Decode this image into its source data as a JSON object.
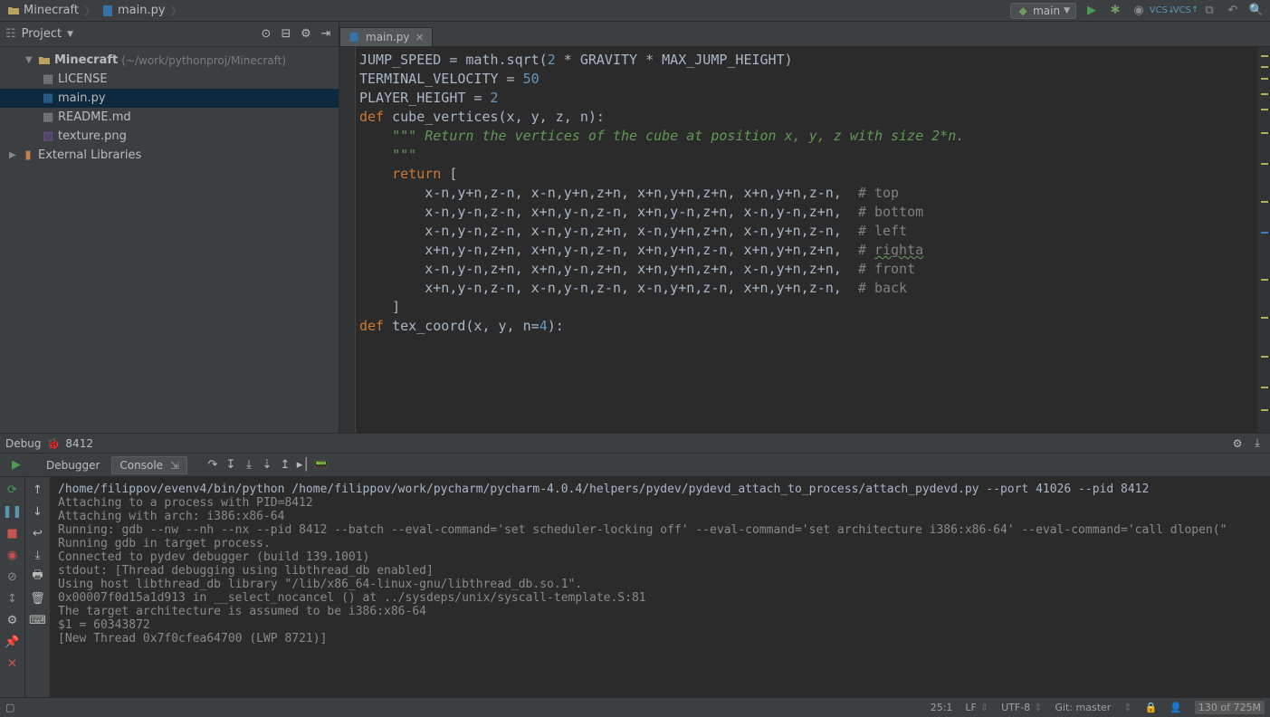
{
  "breadcrumb": {
    "project": "Minecraft",
    "file": "main.py"
  },
  "run_config": "main",
  "sidebar": {
    "title": "Project",
    "root": "Minecraft",
    "root_path": "(~/work/pythonproj/Minecraft)",
    "items": [
      {
        "name": "LICENSE",
        "icon": "text",
        "selected": false
      },
      {
        "name": "main.py",
        "icon": "py",
        "selected": true
      },
      {
        "name": "README.md",
        "icon": "text",
        "selected": false
      },
      {
        "name": "texture.png",
        "icon": "img",
        "selected": false
      }
    ],
    "external": "External Libraries"
  },
  "tabs": [
    {
      "label": "main.py"
    }
  ],
  "code_lines": [
    {
      "t": "JUMP_SPEED = math.sqrt(",
      "seg": [
        {
          "s": "JUMP_SPEED = math.sqrt("
        },
        {
          "s": "2",
          "c": "num"
        },
        {
          "s": " * GRAVITY * MAX_JUMP_HEIGHT)"
        }
      ]
    },
    {
      "seg": [
        {
          "s": "TERMINAL_VELOCITY = "
        },
        {
          "s": "50",
          "c": "num"
        }
      ]
    },
    {
      "seg": [
        {
          "s": ""
        }
      ]
    },
    {
      "seg": [
        {
          "s": "PLAYER_HEIGHT = "
        },
        {
          "s": "2",
          "c": "num"
        }
      ]
    },
    {
      "seg": [
        {
          "s": ""
        }
      ]
    },
    {
      "seg": [
        {
          "s": "def ",
          "c": "kw"
        },
        {
          "s": "cube_vertices"
        },
        {
          "s": "(x, y, z, n):"
        }
      ]
    },
    {
      "seg": [
        {
          "s": "    \"\"\" Return the vertices of the cube at position x, y, z with size 2*n.",
          "c": "doc"
        }
      ]
    },
    {
      "seg": [
        {
          "s": ""
        }
      ]
    },
    {
      "seg": [
        {
          "s": "    \"\"\"",
          "c": "doc"
        }
      ]
    },
    {
      "seg": [
        {
          "s": "    "
        },
        {
          "s": "return ",
          "c": "kw"
        },
        {
          "s": "["
        }
      ]
    },
    {
      "seg": [
        {
          "s": "        x-n,y+n,z-n, x-n,y+n,z+n, x+n,y+n,z+n, x+n,y+n,z-n,  "
        },
        {
          "s": "# top",
          "c": "com"
        }
      ]
    },
    {
      "seg": [
        {
          "s": "        x-n,y-n,z-n, x+n,y-n,z-n, x+n,y-n,z+n, x-n,y-n,z+n,  "
        },
        {
          "s": "# bottom",
          "c": "com"
        }
      ]
    },
    {
      "seg": [
        {
          "s": "        x-n,y-n,z-n, x-n,y-n,z+n, x-n,y+n,z+n, x-n,y+n,z-n,  "
        },
        {
          "s": "# left",
          "c": "com"
        }
      ]
    },
    {
      "seg": [
        {
          "s": "        x+n,y-n,z+n, x+n,y-n,z-n, x+n,y+n,z-n, x+n,y+n,z+n,  "
        },
        {
          "s": "# ",
          "c": "com"
        },
        {
          "s": "righta",
          "c": "com typo-squiggle"
        }
      ]
    },
    {
      "seg": [
        {
          "s": "        x-n,y-n,z+n, x+n,y-n,z+n, x+n,y+n,z+n, x-n,y+n,z+n,  "
        },
        {
          "s": "# front",
          "c": "com"
        }
      ]
    },
    {
      "seg": [
        {
          "s": "        x+n,y-n,z-n, x-n,y-n,z-n, x-n,y+n,z-n, x+n,y+n,z-n,  "
        },
        {
          "s": "# back",
          "c": "com"
        }
      ]
    },
    {
      "seg": [
        {
          "s": "    ]"
        }
      ]
    },
    {
      "seg": [
        {
          "s": ""
        }
      ]
    },
    {
      "seg": [
        {
          "s": ""
        }
      ]
    },
    {
      "seg": [
        {
          "s": "def ",
          "c": "kw"
        },
        {
          "s": "tex_coord"
        },
        {
          "s": "(x, y, n="
        },
        {
          "s": "4",
          "c": "num"
        },
        {
          "s": "):"
        }
      ]
    }
  ],
  "debug": {
    "title": "Debug",
    "pid": "8412",
    "tabs": {
      "debugger": "Debugger",
      "console": "Console"
    },
    "console": [
      "/home/filippov/evenv4/bin/python /home/filippov/work/pycharm/pycharm-4.0.4/helpers/pydev/pydevd_attach_to_process/attach_pydevd.py --port 41026 --pid 8412",
      "Attaching to a process with PID=8412",
      "Attaching with arch: i386:x86-64",
      "Running: gdb --nw --nh --nx --pid 8412 --batch --eval-command='set scheduler-locking off' --eval-command='set architecture i386:x86-64' --eval-command='call dlopen(\"",
      "Running gdb in target process.",
      "Connected to pydev debugger (build 139.1001)",
      "stdout: [Thread debugging using libthread_db enabled]",
      "Using host libthread_db library \"/lib/x86_64-linux-gnu/libthread_db.so.1\".",
      "0x00007f0d15a1d913 in __select_nocancel () at ../sysdeps/unix/syscall-template.S:81",
      "The target architecture is assumed to be i386:x86-64",
      "$1 = 60343872",
      "[New Thread 0x7f0cfea64700 (LWP 8721)]"
    ]
  },
  "status": {
    "pos": "25:1",
    "line_end": "LF",
    "encoding": "UTF-8",
    "git": "Git: master",
    "mem": "130 of 725M"
  }
}
